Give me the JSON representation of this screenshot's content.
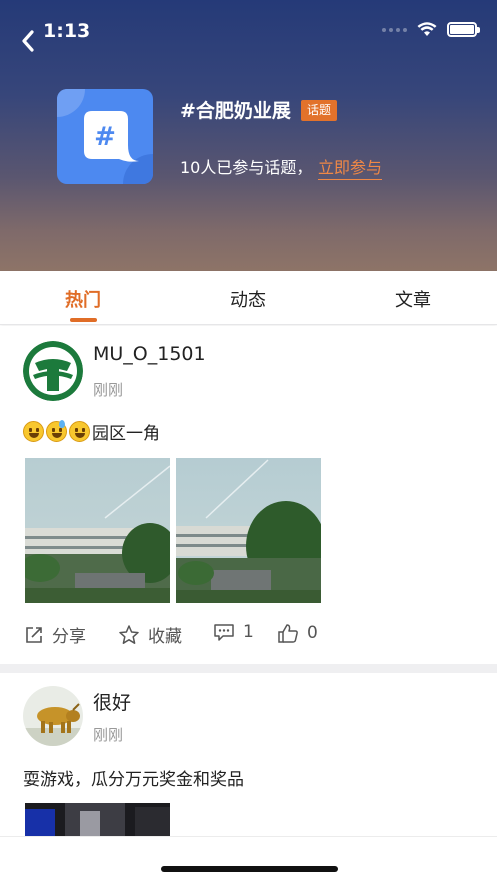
{
  "status_bar": {
    "time": "1:13"
  },
  "topic": {
    "title": "#合肥奶业展",
    "badge": "话题",
    "participants": "10人已参与话题，",
    "join_label": "立即参与",
    "icon_glyph": "#"
  },
  "tabs": [
    {
      "label": "热门",
      "active": true
    },
    {
      "label": "动态",
      "active": false
    },
    {
      "label": "文章",
      "active": false
    }
  ],
  "posts": [
    {
      "username": "MU_O_1501",
      "time": "刚刚",
      "text": "园区一角",
      "emojis": [
        "grinning-face",
        "sweat-smile-face",
        "smiley-face"
      ],
      "actions": {
        "share": "分享",
        "favorite": "收藏",
        "comments": "1",
        "likes": "0"
      }
    },
    {
      "username": "很好",
      "time": "刚刚",
      "text": "耍游戏，瓜分万元奖金和奖品"
    }
  ],
  "colors": {
    "accent": "#e06d27",
    "topic_icon": "#4d89f0",
    "badge": "#e2722b"
  }
}
